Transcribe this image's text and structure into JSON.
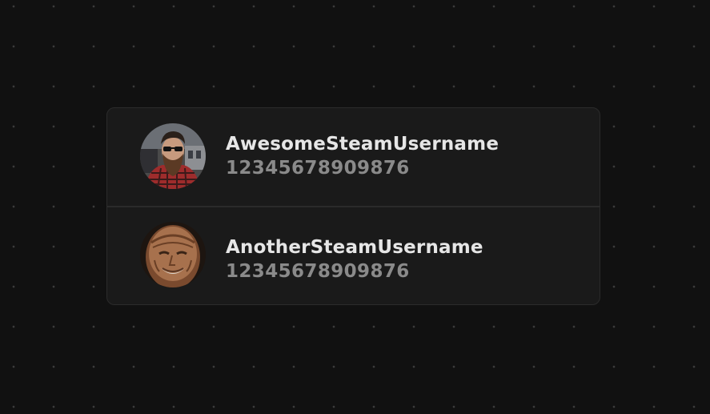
{
  "accounts": [
    {
      "username": "AwesomeSteamUsername",
      "steam_id": "12345678909876",
      "avatar": "bearded-man-sunglasses-avatar"
    },
    {
      "username": "AnotherSteamUsername",
      "steam_id": "12345678909876",
      "avatar": "elderly-man-smiling-avatar"
    }
  ],
  "colors": {
    "background": "#111111",
    "card": "#1a1a1a",
    "username_text": "#e6e6e6",
    "steam_id_text": "#8a8a8a"
  }
}
